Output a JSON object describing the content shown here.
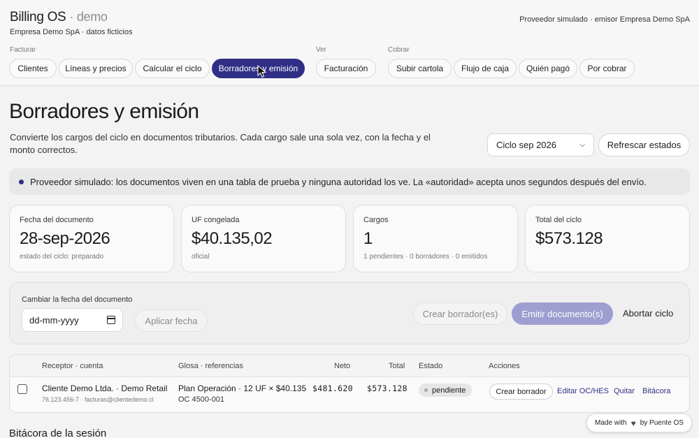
{
  "header": {
    "brand": "Billing OS",
    "brand_suffix": "· demo",
    "company": "Empresa Demo SpA · datos ficticios",
    "provider": "Proveedor simulado · emisor Empresa Demo SpA"
  },
  "nav": {
    "groups": [
      {
        "label": "Facturar"
      },
      {
        "label": "Ver"
      },
      {
        "label": "Cobrar"
      }
    ],
    "items": [
      {
        "label": "Clientes"
      },
      {
        "label": "Líneas y precios"
      },
      {
        "label": "Calcular el ciclo"
      },
      {
        "label": "Borradores y emisión",
        "active": true
      },
      {
        "label": "Facturación"
      },
      {
        "label": "Subir cartola"
      },
      {
        "label": "Flujo de caja"
      },
      {
        "label": "Quién pagó"
      },
      {
        "label": "Por cobrar"
      }
    ]
  },
  "page": {
    "title": "Borradores y emisión",
    "description": "Convierte los cargos del ciclo en documentos tributarios. Cada cargo sale una sola vez, con la fecha y el monto correctos.",
    "cycle_selected": "Ciclo sep 2026",
    "refresh_label": "Refrescar estados"
  },
  "notice": "Proveedor simulado: los documentos viven en una tabla de prueba y ninguna autoridad los ve. La «autoridad» acepta unos segundos después del envío.",
  "stats": [
    {
      "label": "Fecha del documento",
      "value": "28-sep-2026",
      "sub": "estado del ciclo: preparado"
    },
    {
      "label": "UF congelada",
      "value": "$40.135,02",
      "sub": "oficial"
    },
    {
      "label": "Cargos",
      "value": "1",
      "sub": "1 pendientes · 0 borradores · 0 emitidos"
    },
    {
      "label": "Total del ciclo",
      "value": "$573.128",
      "sub": ""
    }
  ],
  "actions": {
    "date_label": "Cambiar la fecha del documento",
    "date_placeholder": "dd-mm-yyyy",
    "apply_label": "Aplicar fecha",
    "create_label": "Crear borrador(es)",
    "emit_label": "Emitir documento(s)",
    "abort_label": "Abortar ciclo"
  },
  "table": {
    "headers": {
      "receptor": "Receptor · cuenta",
      "glosa": "Glosa · referencias",
      "neto": "Neto",
      "total": "Total",
      "estado": "Estado",
      "acciones": "Acciones"
    },
    "rows": [
      {
        "receptor": "Cliente Demo Ltda. · Demo Retail",
        "receptor_sub": "76.123.456-7 · facturas@clientedemo.cl",
        "glosa": "Plan Operación · 12 UF × $40.135",
        "glosa_sub": "OC 4500-001",
        "neto": "$481.620",
        "total": "$573.128",
        "estado": "pendiente",
        "action_create": "Crear borrador",
        "action_edit": "Editar OC/HES",
        "action_remove": "Quitar",
        "action_log": "Bitácora"
      }
    ]
  },
  "log_title": "Bitácora de la sesión",
  "badge": {
    "made_with": "Made with",
    "by": "by Puente OS"
  }
}
